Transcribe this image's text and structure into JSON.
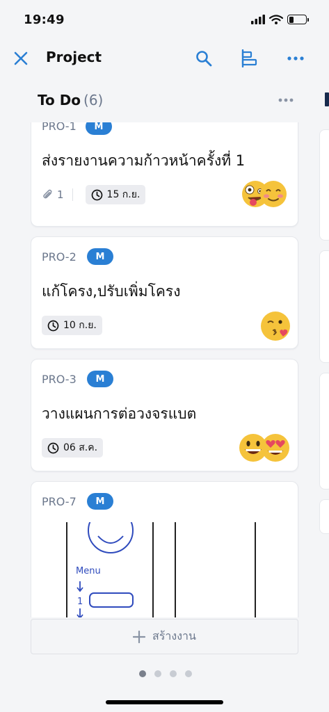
{
  "status_bar": {
    "time": "19:49"
  },
  "header": {
    "title": "Project"
  },
  "column": {
    "title": "To Do",
    "count": "(6)"
  },
  "cards": [
    {
      "key": "PRO-1",
      "badge": "M",
      "title": "ส่งรายงานความก้าวหน้าครั้งที่ 1",
      "attachments": "1",
      "due": "15 ก.ย.",
      "assignees": [
        "zany-face-emoji",
        "smiling-blush-emoji"
      ]
    },
    {
      "key": "PRO-2",
      "badge": "M",
      "title": "แก้โครง,ปรับเพิ่มโครง",
      "due": "10 ก.ย.",
      "assignees": [
        "kissing-heart-emoji"
      ]
    },
    {
      "key": "PRO-3",
      "badge": "M",
      "title": "วางแผนการต่อวงจรแบต",
      "due": "06 ส.ค.",
      "assignees": [
        "grinning-face-emoji",
        "heart-eyes-emoji"
      ]
    },
    {
      "key": "PRO-7",
      "badge": "M",
      "sketch_text": [
        "Menu",
        "1"
      ]
    }
  ],
  "footer": {
    "create_label": "สร้างงาน"
  },
  "pager": {
    "pages": 4,
    "active": 1
  },
  "colors": {
    "accent": "#2a7fd4",
    "badge": "#2a7fd4",
    "text": "#172b4d",
    "muted": "#6b778c",
    "background": "#f4f5f7"
  }
}
